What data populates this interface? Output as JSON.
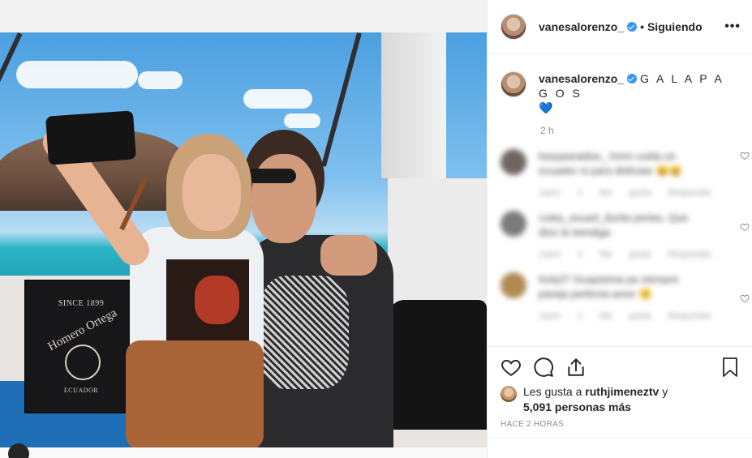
{
  "post": {
    "username": "vanesalorenzo_",
    "follow_label": "Siguiendo",
    "separator": "•",
    "more_label": "•••",
    "caption_title": "G A L A P A G O S",
    "caption_emoji": "💙",
    "time_short": "2 h"
  },
  "photo": {
    "box_since": "SINCE 1899",
    "box_brand": "Homero Ortega",
    "box_origin": "ECUADOR"
  },
  "comments": [
    {
      "line1": "kasyparadise_ hmm cuida un",
      "line2": "ecuador ni para disfrutar 😄😄",
      "meta": "1sem   2 Me gusta   Responder",
      "avatar_color": "#6e6560"
    },
    {
      "line1": "cutey_esuart_tlurita perlas, Que",
      "line2": "dios te bendiga",
      "meta": "1sem   4 Me gusta   Responder",
      "avatar_color": "#7a7b7c"
    },
    {
      "line1": "hola27 Guapisima pa siempre",
      "line2": "pareja perfecta amor 😊",
      "meta": "1sem   1 Me gusta   Responder",
      "avatar_color": "#b08a52"
    }
  ],
  "likes": {
    "prefix": "Les gusta a",
    "user": "ruthjimeneztv",
    "joiner": "y",
    "count_text": "5,091 personas más"
  },
  "ago": "HACE 2 HORAS",
  "icons": {
    "like": "heart-outline-icon",
    "comment": "comment-bubble-icon",
    "share": "share-upload-icon",
    "save": "bookmark-icon",
    "verified": "verified-badge-icon",
    "comment_like": "heart-small-icon"
  },
  "colors": {
    "verified": "#3897f0",
    "text": "#262626",
    "muted": "#8e8e8e"
  }
}
